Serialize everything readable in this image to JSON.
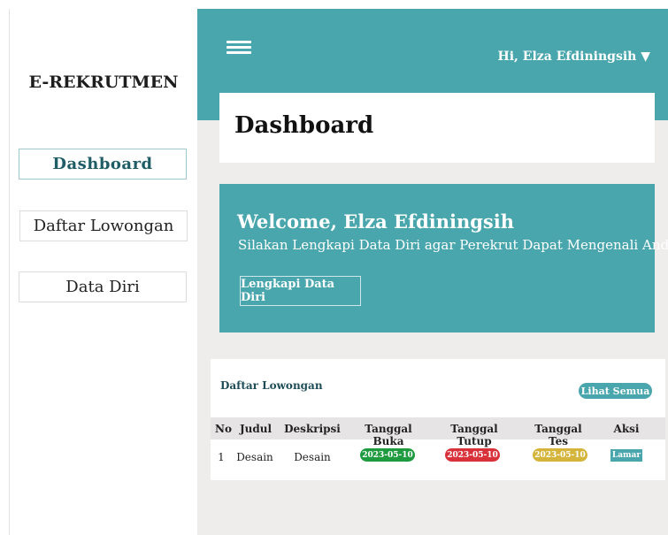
{
  "app": {
    "brand": "E-REKRUTMEN"
  },
  "sidebar": {
    "items": [
      {
        "label": "Dashboard",
        "active": true
      },
      {
        "label": "Daftar Lowongan",
        "active": false
      },
      {
        "label": "Data Diri",
        "active": false
      }
    ]
  },
  "header": {
    "greeting": "Hi, Elza Efdiningsih",
    "menu_icon": "hamburger-icon",
    "dropdown_icon": "caret-down-icon"
  },
  "page": {
    "title": "Dashboard"
  },
  "welcome": {
    "title": "Welcome, Elza Efdiningsih",
    "subtitle": "Silakan Lengkapi Data Diri agar Perekrut Dapat Mengenali Anda",
    "button_label": "Lengkapi Data Diri"
  },
  "jobs": {
    "title": "Daftar Lowongan",
    "see_all_label": "Lihat Semua",
    "columns": [
      "No",
      "Judul",
      "Deskripsi",
      "Tanggal Buka",
      "Tanggal Tutup",
      "Tanggal Tes",
      "Aksi"
    ],
    "rows": [
      {
        "no": "1",
        "judul": "Desain",
        "deskripsi": "Desain",
        "tanggal_buka": "2023-05-10",
        "tanggal_tutup": "2023-05-10",
        "tanggal_tes": "2023-05-10",
        "aksi": "Lamar"
      }
    ]
  },
  "colors": {
    "accent": "#4aa6ad",
    "open": "#1e9a3f",
    "close": "#d8313a",
    "test": "#d4b43a"
  }
}
